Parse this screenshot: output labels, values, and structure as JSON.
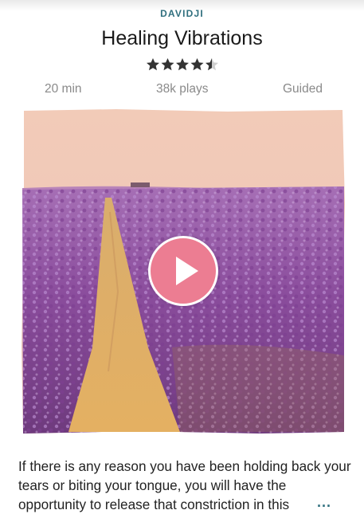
{
  "session": {
    "author": "DAVIDJI",
    "title": "Healing Vibrations",
    "rating": 4.5,
    "duration": "20 min",
    "plays": "38k plays",
    "type": "Guided"
  },
  "artwork": {
    "subject": "lavender field with dirt path",
    "play_icon": "play-icon"
  },
  "description": {
    "text": "If there is any reason you have been holding back your tears or biting your tongue, you will have the opportunity to release that constriction in this",
    "more_label": "..."
  },
  "colors": {
    "accent": "#2f6f7e",
    "play_button": "#ec7d92"
  }
}
